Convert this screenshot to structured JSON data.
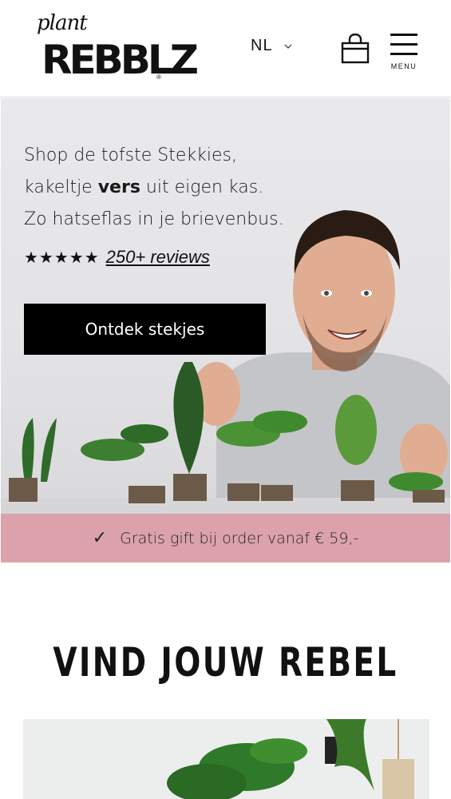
{
  "header": {
    "logo_top": "plant",
    "logo_main": "REBBLZ",
    "logo_reg": "®",
    "language": "NL",
    "menu_label": "MENU"
  },
  "hero": {
    "line1": "Shop de tofste Stekkies,",
    "line2_before": "kakeltje ",
    "line2_bold": "vers",
    "line2_after": " uit eigen kas.",
    "line3": "Zo hatseflas in je brievenbus.",
    "stars": "★★★★★",
    "reviews_link": "250+ reviews",
    "cta_label": "Ontdek stekjes"
  },
  "promo": {
    "check": "✓",
    "text": "Gratis gift bij order vanaf € 59,-"
  },
  "section": {
    "title": "VIND JOUW REBEL"
  },
  "icons": {
    "language_chevron": "chevron-down-icon",
    "cart": "shopping-bag-icon",
    "menu": "hamburger-menu-icon"
  },
  "colors": {
    "promo_bg": "#dca2ab",
    "cta_bg": "#000000",
    "hero_bg": "#e6e6e9"
  }
}
